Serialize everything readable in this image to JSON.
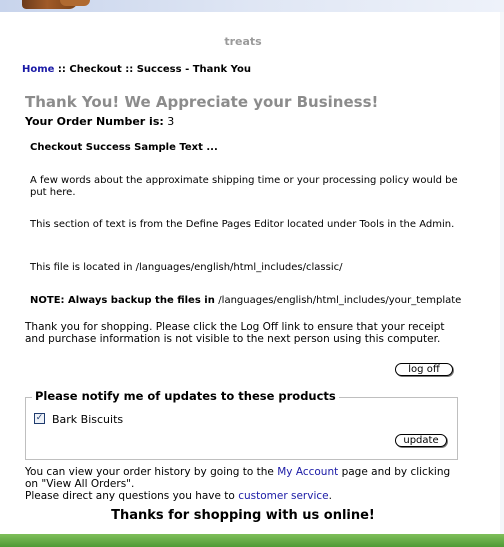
{
  "store": {
    "title": "treats"
  },
  "breadcrumb": {
    "home": "Home",
    "sep1": " :: ",
    "checkout": "Checkout",
    "sep2": " :: ",
    "current": "Success - Thank You"
  },
  "heading": "Thank You! We Appreciate your Business!",
  "order": {
    "label": "Your Order Number is:",
    "number": "3"
  },
  "define_page": {
    "title": "Checkout Success Sample Text ...",
    "p1": "A few words about the approximate shipping time or your processing policy would be put here.",
    "p2": "This section of text is from the Define Pages Editor located under Tools in the Admin.",
    "p3": "This file is located in /languages/english/html_includes/classic/",
    "note_label": "NOTE: Always backup the files in ",
    "note_path": "/languages/english/html_includes/your_template"
  },
  "logoff": {
    "message": "Thank you for shopping. Please click the Log Off link to ensure that your receipt and purchase information is not visible to the next person using this computer.",
    "button": "log off"
  },
  "notify": {
    "legend": "Please notify me of updates to these products",
    "products": [
      {
        "name": "Bark Biscuits",
        "checked": true
      }
    ],
    "button": "update"
  },
  "history": {
    "prefix": "You can view your order history by going to the ",
    "account_link": "My Account",
    "middle": " page and by clicking on \"View All Orders\".",
    "questions": "Please direct any questions you have to ",
    "service_link": "customer service",
    "end": "."
  },
  "footer": {
    "thanks": "Thanks for shopping with us online!"
  }
}
